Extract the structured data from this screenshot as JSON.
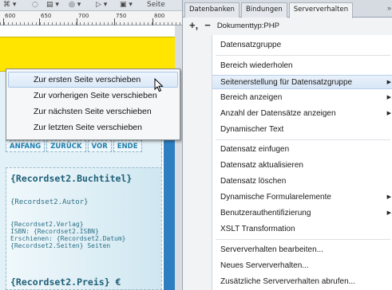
{
  "editor": {
    "ruler_ticks": [
      "600",
      "650",
      "700",
      "750",
      "800"
    ],
    "toolbar_tail": "Seite",
    "nav_buttons": [
      "ANFANG",
      "ZURÜCK",
      "VOR",
      "ENDE"
    ],
    "record_fields": {
      "title": "{Recordset2.Buchtitel}",
      "author": "{Recordset2.Autor}",
      "details": [
        "{Recordset2.Verlag}",
        "ISBN: {Recordset2.ISBN}",
        "Erschienen: {Recordset2.Datum}",
        "{Recordset2.Seiten} Seiten"
      ],
      "price": "{Recordset2.Preis} €"
    }
  },
  "context_menu": {
    "items": [
      {
        "label": "Zur ersten Seite verschieben",
        "hover": true
      },
      {
        "label": "Zur vorherigen Seite verschieben",
        "hover": false
      },
      {
        "label": "Zur nächsten Seite verschieben",
        "hover": false
      },
      {
        "label": "Zur letzten Seite verschieben",
        "hover": false
      }
    ]
  },
  "panel": {
    "tabs": [
      "Datenbanken",
      "Bindungen",
      "Serververhalten"
    ],
    "active_tab": "Serververhalten",
    "more_indicator": "»",
    "add_label": "+,",
    "remove_label": "−",
    "doctype": "Dokumenttyp:PHP",
    "behaviors": [
      {
        "label": "Datensatzgruppe",
        "submenu": false
      },
      {
        "label": "Bereich wiederholen",
        "submenu": false
      },
      {
        "label": "Seitenerstellung für Datensatzgruppe",
        "submenu": true,
        "selected": true
      },
      {
        "label": "Bereich anzeigen",
        "submenu": true
      },
      {
        "label": "Anzahl der Datensätze anzeigen",
        "submenu": true
      },
      {
        "label": "Dynamischer Text",
        "submenu": false
      },
      {
        "label": "Datensatz einfugen",
        "submenu": false
      },
      {
        "label": "Datensatz aktualisieren",
        "submenu": false
      },
      {
        "label": "Datensatz löschen",
        "submenu": false
      },
      {
        "label": "Dynamische Formularelemente",
        "submenu": true
      },
      {
        "label": "Benutzerauthentifizierung",
        "submenu": true
      },
      {
        "label": "XSLT Transformation",
        "submenu": false
      },
      {
        "label": "Serververhalten bearbeiten...",
        "submenu": false
      },
      {
        "label": "Neues Serververhalten...",
        "submenu": false
      },
      {
        "label": "Zusätzliche Serververhalten abrufen...",
        "submenu": false
      }
    ]
  },
  "colors": {
    "highlight_band": "#ffe500",
    "blue_column": "#2d7fc1",
    "field_text": "#2b6f86"
  }
}
